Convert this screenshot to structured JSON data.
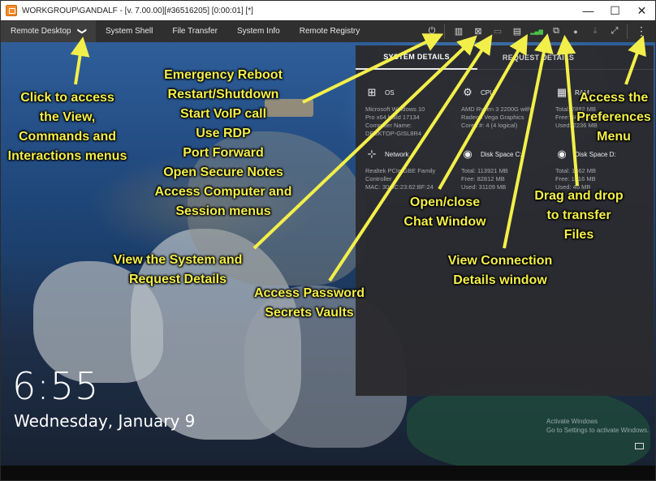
{
  "window": {
    "title": "WORKGROUP\\GANDALF -  [v. 7.00.00][#36516205] [0:00:01] [*]",
    "controls": {
      "minimize": "—",
      "maximize": "☐",
      "close": "✕"
    }
  },
  "toolbar": {
    "tabs": [
      {
        "label": "Remote Desktop",
        "active": true
      },
      {
        "label": "System Shell"
      },
      {
        "label": "File Transfer"
      },
      {
        "label": "System Info"
      },
      {
        "label": "Remote Registry"
      }
    ],
    "dropdown_glyph": "❯",
    "icons": [
      {
        "name": "power-menu-icon",
        "glyph": "⏻"
      },
      {
        "name": "system-details-icon",
        "glyph": "▥"
      },
      {
        "name": "password-vault-icon",
        "glyph": "⊠"
      },
      {
        "name": "monitor-icon",
        "glyph": "▭"
      },
      {
        "name": "chat-icon",
        "glyph": "▤"
      },
      {
        "name": "signal-strength-icon",
        "glyph": "▂▄▆"
      },
      {
        "name": "file-transfer-icon",
        "glyph": "⧉"
      },
      {
        "name": "record-icon",
        "glyph": "●"
      },
      {
        "name": "download-icon",
        "glyph": "⤓"
      },
      {
        "name": "fullscreen-icon",
        "glyph": "⤢"
      },
      {
        "name": "more-menu-icon",
        "glyph": "⋮"
      }
    ]
  },
  "panel": {
    "tabs": [
      "SYSTEM DETAILS",
      "REQUEST DETAILS"
    ],
    "cells": [
      {
        "title": "OS",
        "icon": "windows-icon",
        "glyph": "⊞",
        "lines": [
          "Microsoft Windows 10",
          "Pro x64 build 17134",
          "Computer Name:",
          "DESKTOP-GISL8R4"
        ]
      },
      {
        "title": "CPU",
        "icon": "cpu-icon",
        "glyph": "⚙",
        "lines": [
          "AMD Ryzen 3 2200G with",
          "Radeon Vega Graphics",
          "Cores #: 4 (4 logical)"
        ]
      },
      {
        "title": "RAM",
        "icon": "ram-icon",
        "glyph": "▦",
        "lines": [
          "Total: 7882 MB",
          "Free: 5646 MB",
          "Used: 2236 MB"
        ]
      },
      {
        "title": "Network",
        "icon": "network-icon",
        "glyph": "⊹",
        "lines": [
          "Realtek PCIe GBE Family",
          "Controller",
          "MAC: 30:9C:23:62:BF:24"
        ]
      },
      {
        "title": "Disk Space C:",
        "icon": "disk-c-icon",
        "glyph": "◉",
        "lines": [
          "Total: 113921 MB",
          "Free: 82812 MB",
          "Used: 31109 MB"
        ]
      },
      {
        "title": "Disk Space D:",
        "icon": "disk-d-icon",
        "glyph": "◉",
        "lines": [
          "Total: 1862 MB",
          "Free: 1816 MB",
          "Used: 46 MB"
        ]
      }
    ]
  },
  "lockscreen": {
    "time": "6:55",
    "date": "Wednesday, January 9",
    "activate_line1": "Activate Windows",
    "activate_line2": "Go to Settings to activate Windows."
  },
  "annotations": {
    "view_menu": [
      "Click to access",
      "the View,",
      "Commands and",
      "Interactions menus"
    ],
    "power_menu": [
      "Emergency Reboot",
      "Restart/Shutdown",
      "Start VoIP call",
      "Use RDP",
      "Port Forward",
      "Open Secure Notes",
      "Access Computer and",
      "Session menus"
    ],
    "system_details": [
      "View the System and",
      "Request Details"
    ],
    "password_vault": [
      "Access Password",
      "Secrets Vaults"
    ],
    "chat": [
      "Open/close",
      "Chat Window"
    ],
    "connection": [
      "View Connection",
      "Details window"
    ],
    "file_transfer": [
      "Drag and drop",
      "to transfer",
      "Files"
    ],
    "preferences": [
      "Access the",
      "Preferences",
      "Menu"
    ]
  }
}
